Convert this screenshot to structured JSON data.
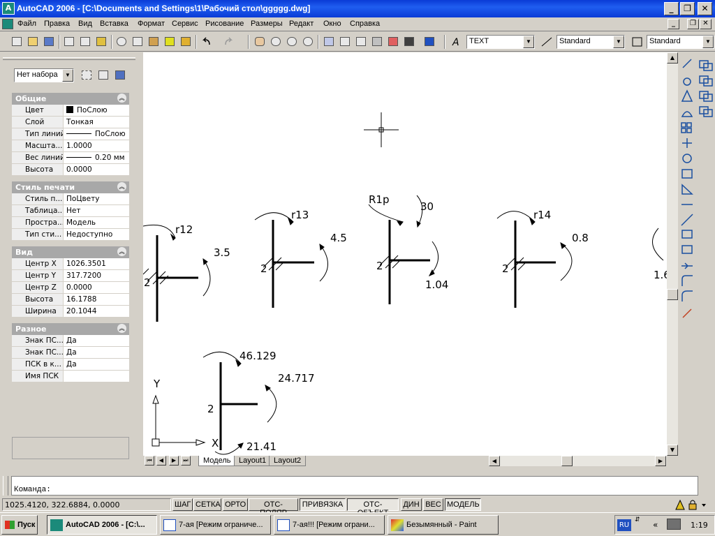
{
  "window": {
    "title": "AutoCAD 2006 - [C:\\Documents and Settings\\1\\Рабочий стол\\ggggg.dwg]",
    "app_icon": "autocad-icon"
  },
  "menu": [
    "Файл",
    "Правка",
    "Вид",
    "Вставка",
    "Формат",
    "Сервис",
    "Рисование",
    "Размеры",
    "Редакт",
    "Окно",
    "Справка"
  ],
  "toolbar": {
    "text_style": "TEXT",
    "dim_style": "Standard",
    "table_style": "Standard"
  },
  "properties": {
    "selection": "Нет набора",
    "groups": [
      {
        "title": "Общие",
        "rows": [
          [
            "Цвет",
            "ПоСлою"
          ],
          [
            "Слой",
            "Тонкая"
          ],
          [
            "Тип линий",
            "ПоСлою"
          ],
          [
            "Масшта...",
            "1.0000"
          ],
          [
            "Вес линий",
            "0.20 мм"
          ],
          [
            "Высота",
            "0.0000"
          ]
        ]
      },
      {
        "title": "Стиль печати",
        "rows": [
          [
            "Стиль п...",
            "ПоЦвету"
          ],
          [
            "Таблица...",
            "Нет"
          ],
          [
            "Простра...",
            "Модель"
          ],
          [
            "Тип сти...",
            "Недоступно"
          ]
        ]
      },
      {
        "title": "Вид",
        "rows": [
          [
            "Центр X",
            "1026.3501"
          ],
          [
            "Центр Y",
            "317.7200"
          ],
          [
            "Центр Z",
            "0.0000"
          ],
          [
            "Высота",
            "16.1788"
          ],
          [
            "Ширина",
            "20.1044"
          ]
        ]
      },
      {
        "title": "Разное",
        "rows": [
          [
            "Знак ПС...",
            "Да"
          ],
          [
            "Знак ПС...",
            "Да"
          ],
          [
            "ПСК в к...",
            "Да"
          ],
          [
            "Имя ПСК",
            ""
          ]
        ]
      }
    ]
  },
  "drawing": {
    "symbols": [
      {
        "top": "r12",
        "right": "3.5",
        "left": "2"
      },
      {
        "top": "r13",
        "right": "4.5",
        "left": "2"
      },
      {
        "top_left": "R1p",
        "top_right": "30",
        "right": "1.04",
        "left": "2"
      },
      {
        "top": "r14",
        "right": "0.8",
        "left": "2"
      },
      {
        "partial": "1.6"
      },
      {
        "top": "46.129",
        "right": "24.717",
        "bottom": "21.41",
        "left": "2"
      }
    ],
    "ucs": {
      "y": "Y",
      "x": "X"
    }
  },
  "tabs": [
    "Модель",
    "Layout1",
    "Layout2"
  ],
  "command": {
    "prompt": "Команда:"
  },
  "status": {
    "coords": "1025.4120, 322.6884, 0.0000",
    "toggles": [
      "ШАГ",
      "СЕТКА",
      "ОРТО",
      "ОТС-ПОЛЯР",
      "ПРИВЯЗКА",
      "ОТС-ОБЪЕКТ",
      "ДИН",
      "ВЕС",
      "МОДЕЛЬ"
    ],
    "on": [
      "ПРИВЯЗКА",
      "ОТС-ОБЪЕКТ",
      "МОДЕЛЬ"
    ]
  },
  "taskbar": {
    "start": "Пуск",
    "tasks": [
      "AutoCAD 2006 - [C:\\...",
      "7-ая [Режим ограниче...",
      "7-ая!!! [Режим ограни...",
      "Безымянный - Paint"
    ],
    "lang": "RU",
    "clock": "1:19"
  }
}
